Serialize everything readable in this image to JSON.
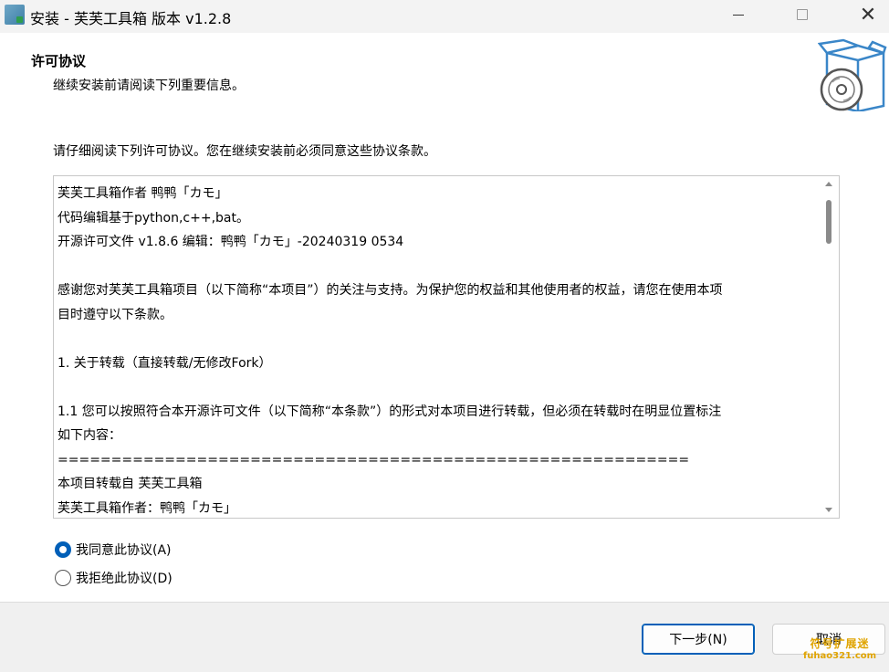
{
  "window": {
    "title": "安装 - 芙芙工具箱 版本 v1.2.8",
    "minimize_icon": "minimize-icon",
    "maximize_icon": "maximize-icon",
    "close_glyph": "✕"
  },
  "header": {
    "title": "许可协议",
    "subtitle": "继续安装前请阅读下列重要信息。",
    "graphic_icon": "installer-box-disc-icon"
  },
  "intro": "请仔细阅读下列许可协议。您在继续安装前必须同意这些协议条款。",
  "license": {
    "lines": [
      "芙芙工具箱作者 鸭鸭「カモ」",
      "代码编辑基于python,c++,bat。",
      "开源许可文件 v1.8.6 编辑：鸭鸭「カモ」-20240319 0534",
      "",
      "感谢您对芙芙工具箱项目（以下简称“本项目”）的关注与支持。为保护您的权益和其他使用者的权益，请您在使用本项",
      "目时遵守以下条款。",
      "",
      "1. 关于转载（直接转载/无修改Fork）",
      "",
      "1.1 您可以按照符合本开源许可文件（以下简称“本条款”）的形式对本项目进行转载，但必须在转载时在明显位置标注",
      "如下内容：",
      "===========================================================",
      "本项目转载自 芙芙工具箱",
      "芙芙工具箱作者：鸭鸭「カモ」"
    ]
  },
  "options": {
    "accept": "我同意此协议(A)",
    "decline": "我拒绝此协议(D)",
    "selected": "accept"
  },
  "buttons": {
    "next": "下一步(N)",
    "cancel": "取消"
  },
  "watermark": {
    "top": "符号扩展迷",
    "bottom": "fuhao321.com"
  }
}
